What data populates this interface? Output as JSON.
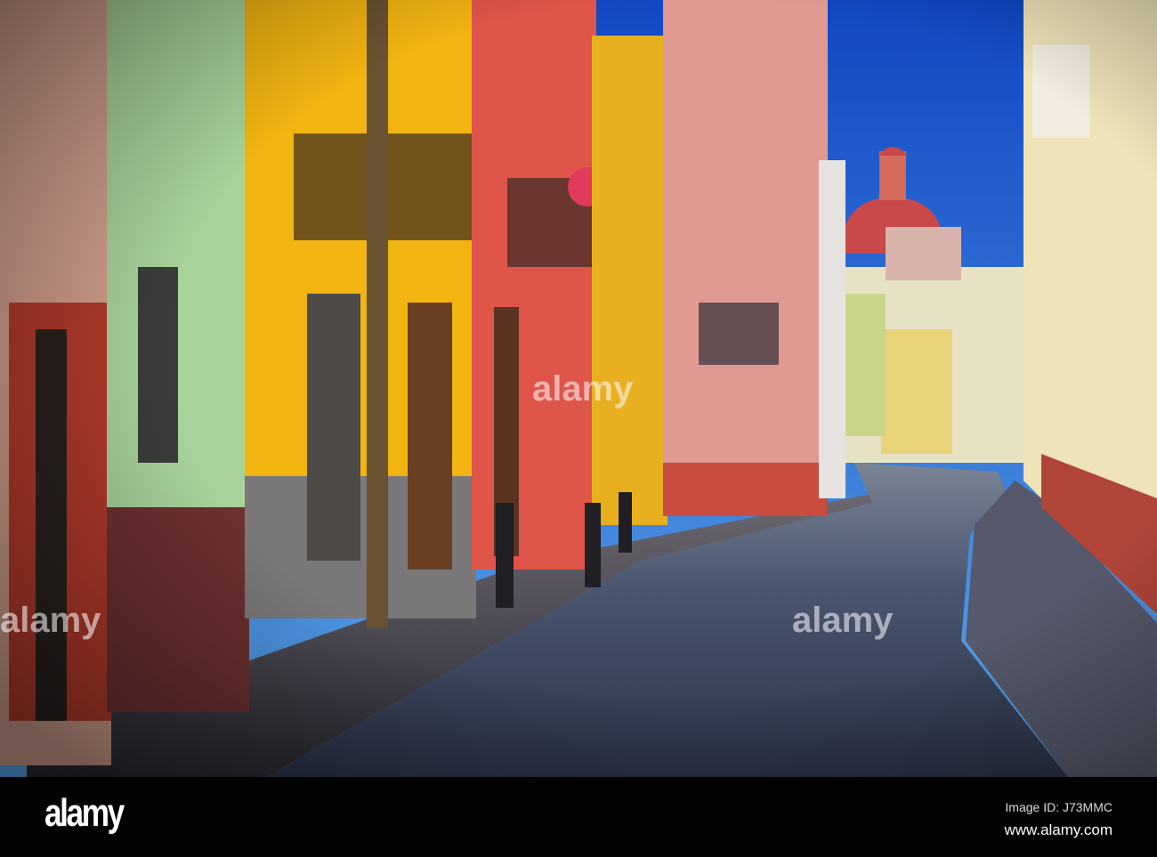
{
  "footer": {
    "logo": "alamy",
    "image_id": "Image ID: J73MMC",
    "url": "www.alamy.com"
  },
  "watermark": "alamy",
  "colors": {
    "sky": "#1f5fd0",
    "yellow_building": "#f2b410",
    "red_building": "#e0554a",
    "green_building": "#a9d39b",
    "pink_building": "#e09a92",
    "road": "#3e4a60",
    "dome": "#c9484a"
  }
}
